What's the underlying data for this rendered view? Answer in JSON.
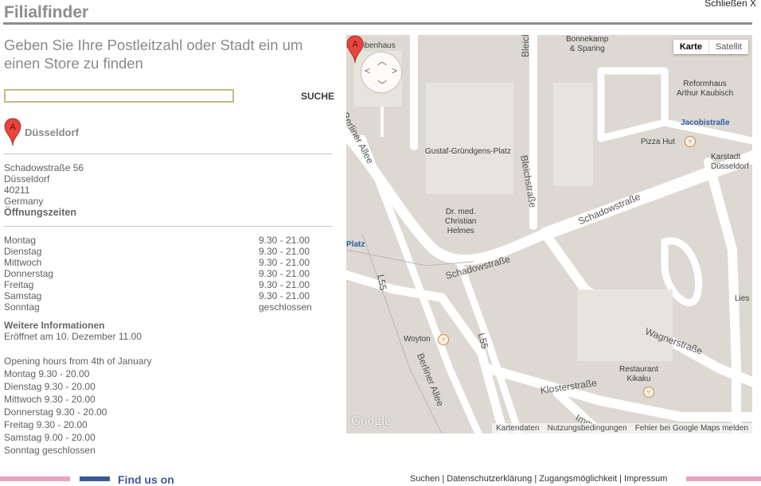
{
  "header": {
    "title": "Filialfinder",
    "close_label": "Schließen X"
  },
  "intro_text": "Geben Sie Ihre Postleitzahl oder Stadt ein um einen Store zu finden",
  "search": {
    "value": "",
    "placeholder": "",
    "button_label": "SUCHE"
  },
  "result": {
    "marker_letter": "A",
    "city": "Düsseldorf",
    "address": [
      "Schadowstraße 56",
      "Düsseldorf",
      "40211",
      "Germany"
    ],
    "opening_hours_heading": "Öffnungszeiten",
    "hours": [
      {
        "day": "Montag",
        "time": "9.30 - 21.00"
      },
      {
        "day": "Dienstag",
        "time": "9.30 - 21.00"
      },
      {
        "day": "Mittwoch",
        "time": "9.30 - 21.00"
      },
      {
        "day": "Donnerstag",
        "time": "9.30 - 21.00"
      },
      {
        "day": "Freitag",
        "time": "9.30 - 21.00"
      },
      {
        "day": "Samstag",
        "time": "9.30 - 21.00"
      },
      {
        "day": "Sonntag",
        "time": "geschlossen"
      }
    ],
    "more_info_heading": "Weitere Informationen",
    "opened_text": "Eröffnet am 10. Dezember 11.00",
    "special_hours": [
      "Opening hours from 4th of January",
      "Montag 9.30 - 20.00",
      "Dienstag 9.30 - 20.00",
      "Mittwoch 9.30 - 20.00",
      "Donnerstag 9.30 - 20.00",
      "Freitag 9.30 - 20.00",
      "Samstag 9.00 - 20.00",
      "Sonntag geschlossen"
    ]
  },
  "map": {
    "type_buttons": {
      "map": "Karte",
      "satellite": "Satellit"
    },
    "labels": {
      "scheibenhaus": "scheibenhaus",
      "bonnekamp": "Bonnekamp\n& Sparing",
      "reformhaus": "Reformhaus\nArthur Kaubisch",
      "jacobistrasse": "Jacobistraße",
      "pizza_hut": "Pizza Hut",
      "karstadt": "Karstadt\nDüsseldorf",
      "gustaf": "Gustaf-Gründgens-Platz",
      "dr_med": "Dr. med.\nChristian\nHelmes",
      "platz": "Platz",
      "woyton": "Woyton",
      "restaurant": "Restaurant\nKikaku",
      "lies": "Lies"
    },
    "streets": {
      "bleichstrasse_top": "Bleichstraße",
      "bleichstrasse": "Bleichstraße",
      "berliner_allee_top": "Berliner Allee",
      "schadowstrasse_right": "Schadowstraße",
      "schadowstrasse_left": "Schadowstraße",
      "l55_left": "L55",
      "l55_right": "L55",
      "wagnerstrasse": "Wagnerstraße",
      "berliner_allee_bottom": "Berliner Allee",
      "klosterstrasse": "Klosterstraße",
      "imm": "Imm"
    },
    "google_logo": "Google",
    "attribution": [
      "Kartendaten",
      "Nutzungsbedingungen",
      "Fehler bei Google Maps melden"
    ]
  },
  "footer": {
    "find_us": "Find us on",
    "links_text": "Suchen | Datenschutzerklärung | Zugangsmöglichkeit | Impressum"
  },
  "colors": {
    "title": "#8d8d8d",
    "input_border": "#c8b78a",
    "marker": "#e8453c",
    "map_bg": "#ddd9d2",
    "footer_pink": "#e9a3c2"
  }
}
